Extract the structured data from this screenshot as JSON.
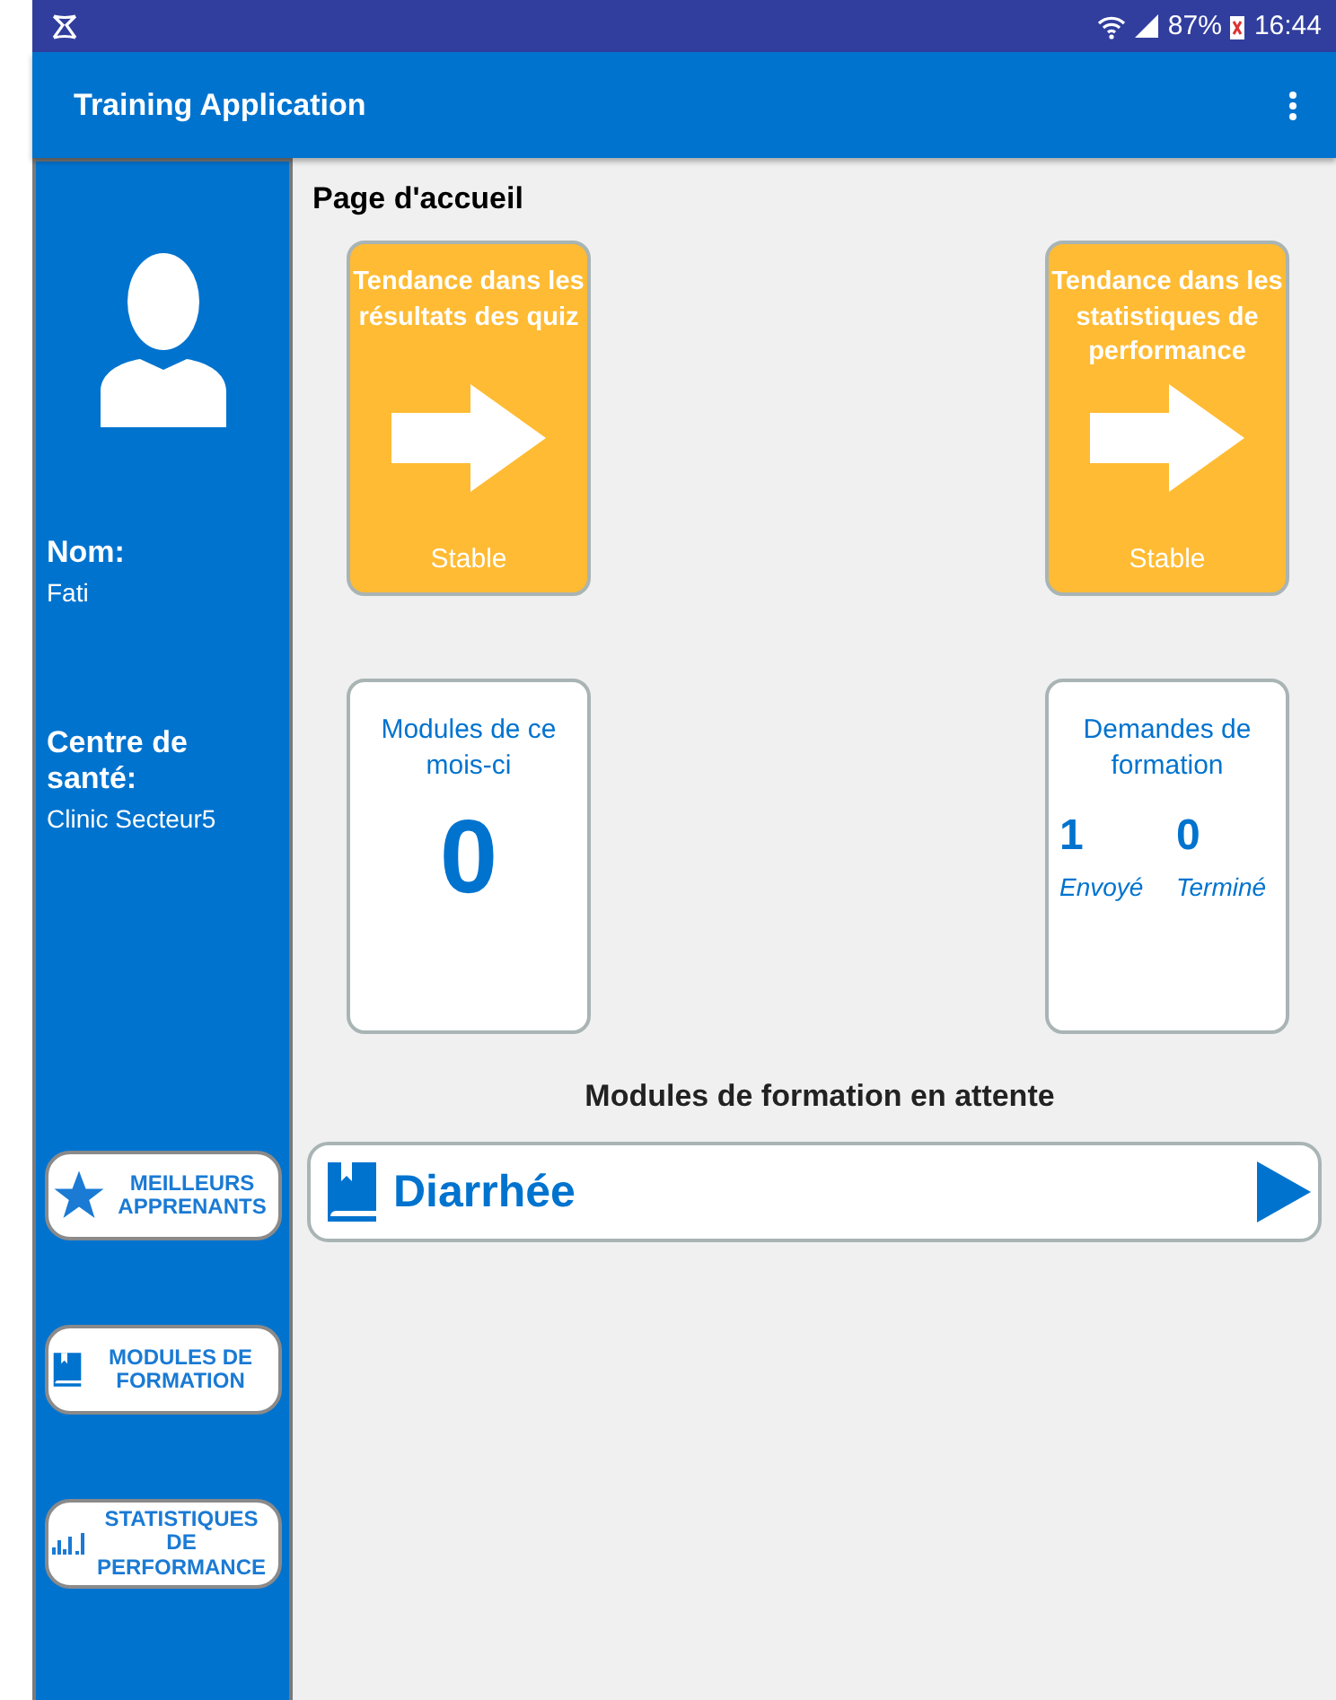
{
  "status_bar": {
    "battery": "87%",
    "time": "16:44"
  },
  "app_bar": {
    "title": "Training Application"
  },
  "sidebar": {
    "name_label": "Nom:",
    "name": "Fati",
    "centre_label": "Centre de santé:",
    "centre": "Clinic Secteur5",
    "buttons": [
      {
        "kind": "star",
        "label": "MEILLEURS APPRENANTS"
      },
      {
        "kind": "book",
        "label": "MODULES DE FORMATION"
      },
      {
        "kind": "chart",
        "label": "STATISTIQUES DE PERFORMANCE"
      }
    ]
  },
  "page_title": "Page d'accueil",
  "trend_cards": [
    {
      "title": "Tendance dans les résultats des quiz",
      "status": "Stable"
    },
    {
      "title": "Tendance dans les statistiques de performance",
      "status": "Stable"
    }
  ],
  "modules_card": {
    "title": "Modules de ce mois-ci",
    "count": "0"
  },
  "requests_card": {
    "title": "Demandes de formation",
    "stats": [
      {
        "value": "1",
        "label": "Envoyé"
      },
      {
        "value": "0",
        "label": "Terminé"
      }
    ]
  },
  "pending": {
    "title": "Modules de formation en attente",
    "modules": [
      {
        "name": "Diarrhée"
      }
    ]
  }
}
